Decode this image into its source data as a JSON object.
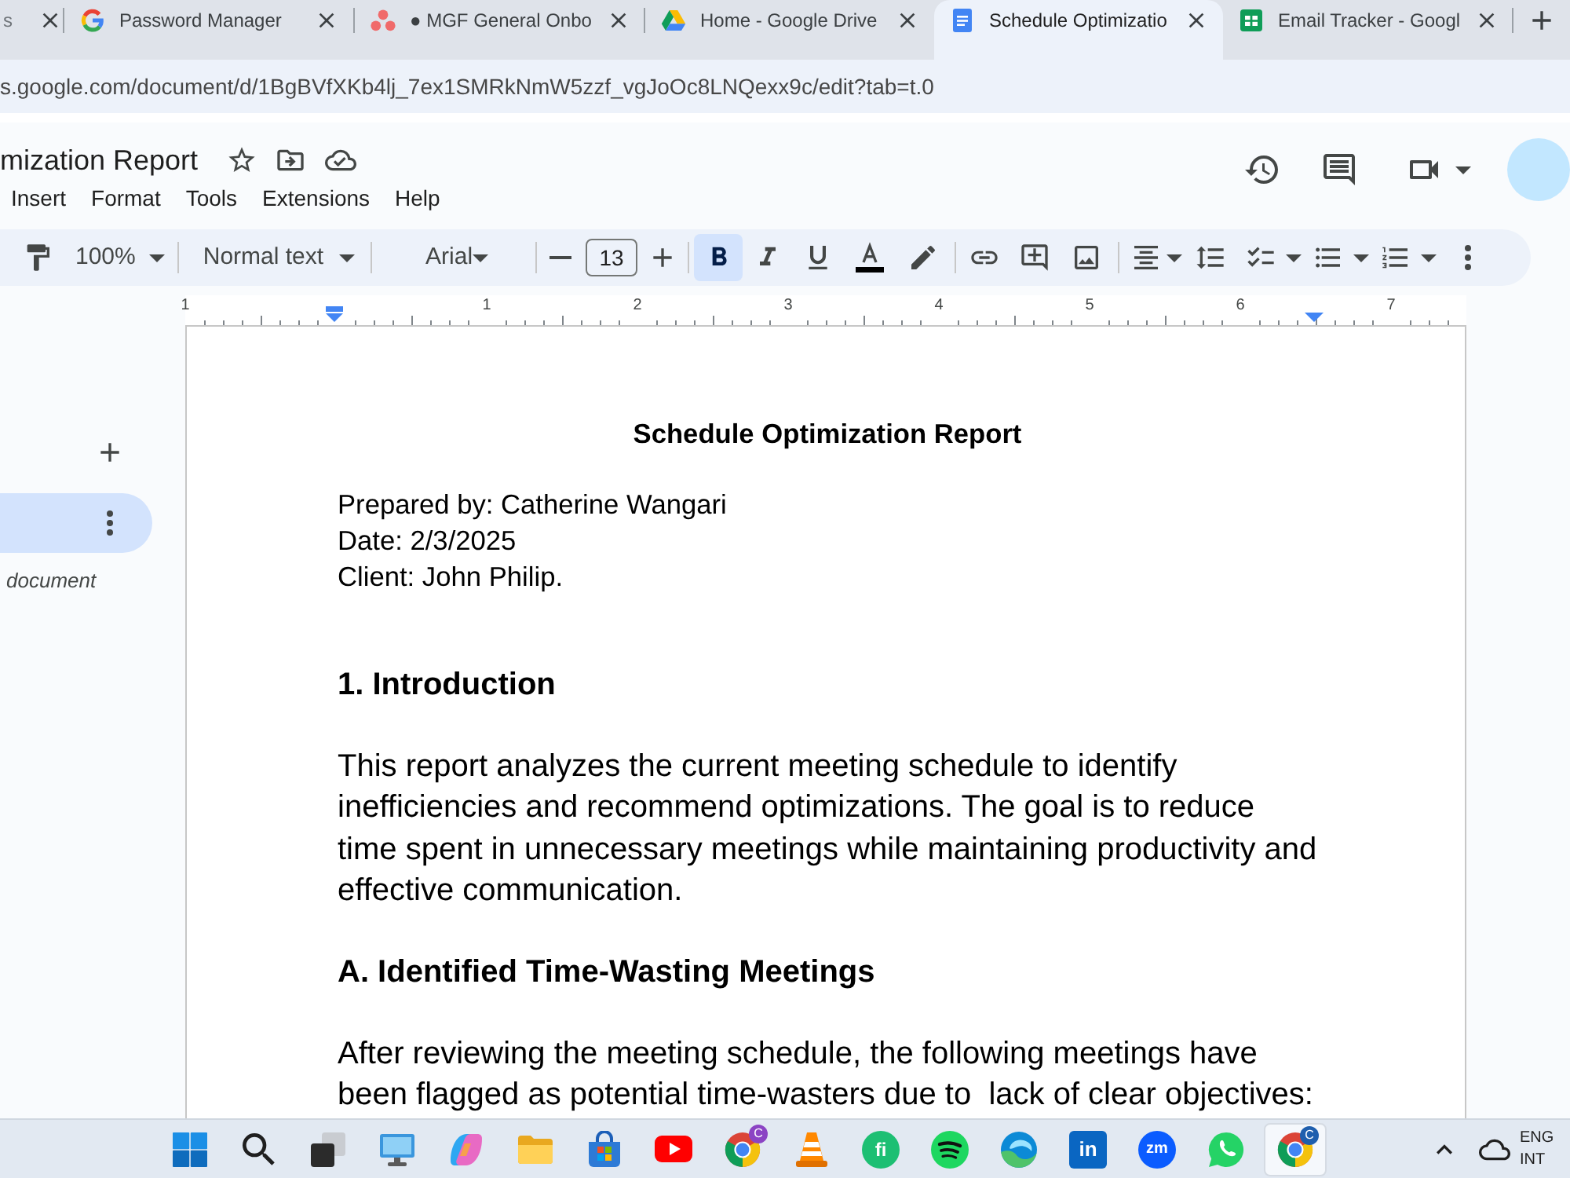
{
  "browser": {
    "tabs": [
      {
        "kind": "none",
        "title": "s",
        "selected": false
      },
      {
        "kind": "google",
        "title": "Password Manager",
        "selected": false
      },
      {
        "kind": "asana",
        "title": "● MGF General Onbo",
        "selected": false
      },
      {
        "kind": "drive",
        "title": "Home - Google Drive",
        "selected": false
      },
      {
        "kind": "docs",
        "title": "Schedule Optimizatio",
        "selected": true
      },
      {
        "kind": "sheets",
        "title": "Email Tracker - Googl",
        "selected": false
      }
    ],
    "url": "s.google.com/document/d/1BgBVfXKb4lj_7ex1SMRkNmW5zzf_vgJoOc8LNQexx9c/edit?tab=t.0"
  },
  "docs_header": {
    "title": "mization Report",
    "menu": [
      "Insert",
      "Format",
      "Tools",
      "Extensions",
      "Help"
    ]
  },
  "toolbar": {
    "zoom": "100%",
    "style": "Normal text",
    "font": "Arial",
    "font_size": "13",
    "bold": true,
    "italic": false,
    "underline": false
  },
  "ruler": {
    "labels": [
      "1",
      "1",
      "2",
      "3",
      "4",
      "5",
      "6",
      "7"
    ]
  },
  "outline": {
    "tab": {
      "selected": true
    },
    "hint": "document"
  },
  "document": {
    "title": "Schedule Optimization Report",
    "meta": [
      "Prepared by: Catherine Wangari",
      "Date: 2/3/2025",
      "Client: John Philip."
    ],
    "blocks": [
      {
        "kind": "heading",
        "text": "1. Introduction"
      },
      {
        "kind": "paragraph",
        "text": "This report analyzes the current meeting schedule to identify inefficiencies and recommend optimizations. The goal is to reduce time spent in unnecessary meetings while maintaining productivity and effective communication."
      },
      {
        "kind": "heading",
        "text": "A. Identified Time-Wasting Meetings"
      },
      {
        "kind": "paragraph",
        "text": "After reviewing the meeting schedule, the following meetings have been flagged as potential time-wasters due to  lack of clear objectives:"
      }
    ]
  },
  "taskbar": {
    "apps": [
      {
        "kind": "windows",
        "selected": false
      },
      {
        "kind": "search",
        "selected": false
      },
      {
        "kind": "task-view",
        "selected": false
      },
      {
        "kind": "desktop",
        "selected": false
      },
      {
        "kind": "copilot",
        "selected": false
      },
      {
        "kind": "explorer",
        "selected": false
      },
      {
        "kind": "store",
        "selected": false
      },
      {
        "kind": "youtube",
        "selected": false
      },
      {
        "kind": "chrome",
        "selected": false,
        "badge": "C",
        "color": "#8b44c4"
      },
      {
        "kind": "vlc",
        "selected": false
      },
      {
        "kind": "fi",
        "glyph": "fi",
        "selected": false
      },
      {
        "kind": "spotify",
        "selected": false
      },
      {
        "kind": "edge",
        "selected": false
      },
      {
        "kind": "linkedin",
        "glyph": "in",
        "selected": false
      },
      {
        "kind": "zoom",
        "glyph": "zm",
        "selected": false
      },
      {
        "kind": "whatsapp",
        "selected": false
      },
      {
        "kind": "chrome",
        "selected": true,
        "badge": "C",
        "color": "#1f5fae"
      }
    ],
    "language": [
      "ENG",
      "INT"
    ]
  }
}
